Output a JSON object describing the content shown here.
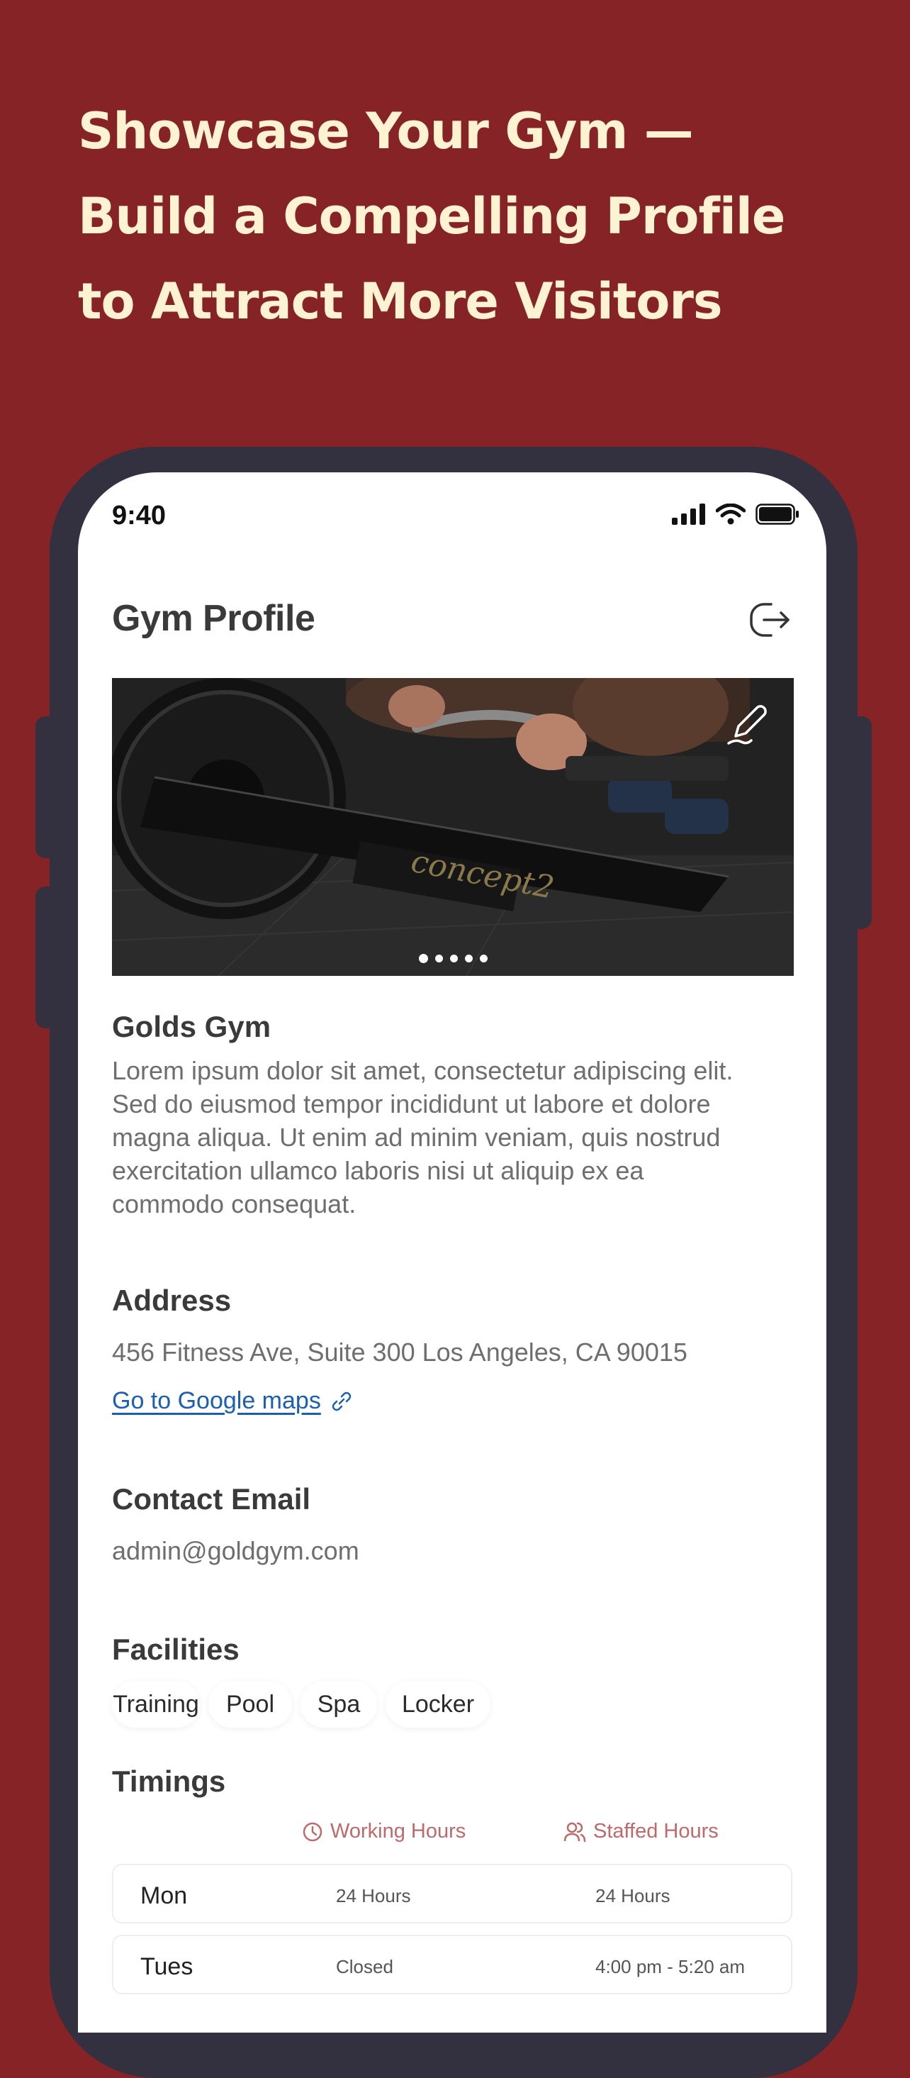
{
  "headline": [
    "Showcase Your Gym —",
    "Build a Compelling Profile",
    "to Attract More Visitors"
  ],
  "status_bar": {
    "time": "9:40",
    "icons": [
      "cellular-signal-icon",
      "wifi-icon",
      "battery-icon"
    ]
  },
  "header": {
    "title": "Gym Profile",
    "action_icon": "logout-icon"
  },
  "hero": {
    "edit_icon": "pencil-icon",
    "slide_count": 5,
    "active_slide": 1
  },
  "gym": {
    "name": "Golds Gym",
    "description_lines": [
      "Lorem ipsum dolor sit amet, consectetur adipiscing elit.",
      "Sed do eiusmod tempor incididunt ut labore et dolore",
      "magna aliqua. Ut enim ad minim veniam, quis nostrud",
      "exercitation ullamco laboris nisi ut aliquip ex ea",
      "commodo consequat."
    ]
  },
  "address": {
    "heading": "Address",
    "value": "456 Fitness Ave, Suite 300 Los Angeles, CA 90015",
    "link_label": "Go to Google maps",
    "link_icon": "external-link-icon"
  },
  "contact": {
    "heading": "Contact Email",
    "value": "admin@goldgym.com"
  },
  "facilities": {
    "heading": "Facilities",
    "items": [
      "Training",
      "Pool",
      "Spa",
      "Locker"
    ]
  },
  "timings": {
    "heading": "Timings",
    "columns": {
      "working": "Working Hours",
      "staffed": "Staffed Hours"
    },
    "rows": [
      {
        "day": "Mon",
        "working": "24 Hours",
        "staffed": "24 Hours"
      },
      {
        "day": "Tues",
        "working": "Closed",
        "staffed": "4:00 pm - 5:20 am"
      }
    ]
  },
  "colors": {
    "background": "#862326",
    "headline": "#fdf2d2",
    "phone_frame": "#33303f",
    "link": "#1a5fb4",
    "timings_header": "#c0696b"
  }
}
